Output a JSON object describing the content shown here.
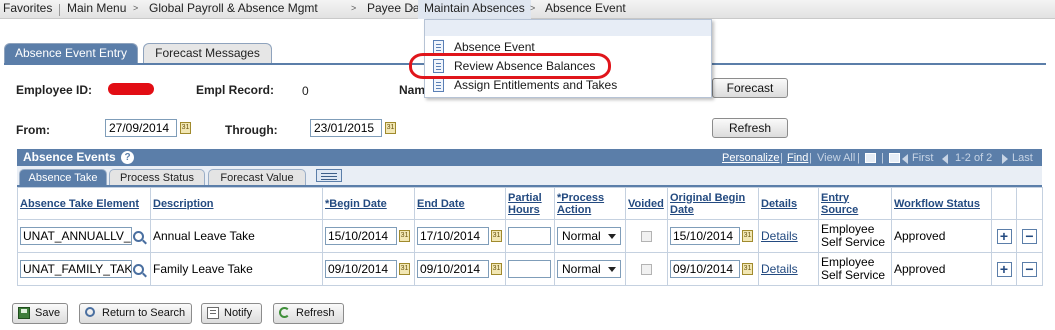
{
  "nav": {
    "favorites": "Favorites",
    "main_menu": "Main Menu",
    "global_payroll": "Global Payroll & Absence Mgmt",
    "payee_data": "Payee Data",
    "maintain_absences": "Maintain Absences",
    "absence_event": "Absence Event"
  },
  "menu": {
    "items": [
      "Absence Event",
      "Review Absence Balances",
      "Assign Entitlements and Takes"
    ],
    "highlight_color": "#e0151b"
  },
  "page_tabs": {
    "active": "Absence Event Entry",
    "inactive": "Forecast Messages"
  },
  "form": {
    "employee_id_label": "Employee ID:",
    "empl_record_label": "Empl Record:",
    "empl_record_value": "0",
    "name_label": "Nam",
    "from_label": "From:",
    "from_value": "27/09/2014",
    "through_label": "Through:",
    "through_value": "23/01/2015",
    "forecast_button": "Forecast",
    "refresh_button": "Refresh"
  },
  "grid": {
    "title": "Absence Events",
    "personalize": "Personalize",
    "find": "Find",
    "separator": "|",
    "view_all": "View All",
    "first": "First",
    "range": "1-2 of 2",
    "last": "Last",
    "tabs": [
      "Absence Take",
      "Process Status",
      "Forecast Value"
    ],
    "columns": [
      "Absence Take Element",
      "Description",
      "*Begin Date",
      "End Date",
      "Partial Hours",
      "*Process Action",
      "Voided",
      "Original Begin Date",
      "Details",
      "Entry Source",
      "Workflow Status"
    ],
    "rows": [
      {
        "element": "UNAT_ANNUALLV_",
        "description": "Annual Leave Take",
        "begin": "15/10/2014",
        "end": "17/10/2014",
        "partial": "",
        "action": "Normal",
        "orig_begin": "15/10/2014",
        "details": "Details",
        "entry_source": "Employee Self Service",
        "workflow": "Approved"
      },
      {
        "element": "UNAT_FAMILY_TAK",
        "description": "Family Leave Take",
        "begin": "09/10/2014",
        "end": "09/10/2014",
        "partial": "",
        "action": "Normal",
        "orig_begin": "09/10/2014",
        "details": "Details",
        "entry_source": "Employee Self Service",
        "workflow": "Approved"
      }
    ]
  },
  "footer": {
    "save": "Save",
    "return_to_search": "Return to Search",
    "notify": "Notify",
    "refresh": "Refresh"
  },
  "colors": {
    "accent": "#5b7ea9",
    "link": "#234a80",
    "redaction": "#e20d14"
  }
}
